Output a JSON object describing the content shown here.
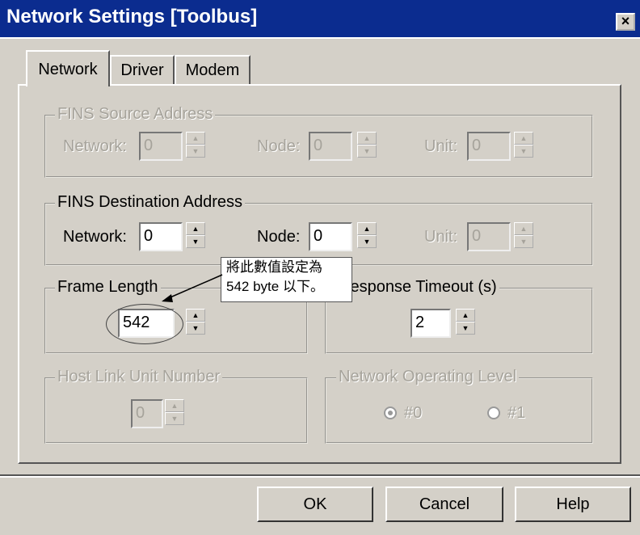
{
  "window": {
    "title": "Network Settings [Toolbus]",
    "close_symbol": "×"
  },
  "tabs": [
    {
      "label": "Network",
      "active": true
    },
    {
      "label": "Driver",
      "active": false
    },
    {
      "label": "Modem",
      "active": false
    }
  ],
  "source_address": {
    "legend": "FINS Source Address",
    "network_label": "Network:",
    "network_value": "0",
    "node_label": "Node:",
    "node_value": "0",
    "unit_label": "Unit:",
    "unit_value": "0"
  },
  "destination_address": {
    "legend": "FINS Destination Address",
    "network_label": "Network:",
    "network_value": "0",
    "node_label": "Node:",
    "node_value": "0",
    "unit_label": "Unit:",
    "unit_value": "0"
  },
  "frame_length": {
    "legend": "Frame Length",
    "value": "542"
  },
  "response_timeout": {
    "legend": "Response Timeout (s)",
    "value": "2"
  },
  "host_link": {
    "legend": "Host Link Unit Number",
    "value": "0"
  },
  "operating_level": {
    "legend": "Network Operating Level",
    "options": [
      "#0",
      "#1"
    ],
    "selected": "#0"
  },
  "annotation": {
    "line1": "將此數值設定為",
    "line2": "542 byte 以下。"
  },
  "spin_glyphs": {
    "up": "▲",
    "down": "▼"
  },
  "buttons": {
    "ok": "OK",
    "cancel": "Cancel",
    "help": "Help"
  }
}
